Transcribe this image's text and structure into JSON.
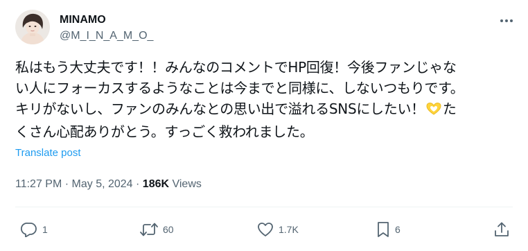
{
  "author": {
    "display_name": "MINAMO",
    "handle": "@M_I_N_A_M_O_",
    "avatar_icon": "profile-photo"
  },
  "post": {
    "lines": [
      "私はもう大丈夫です！！みんなのコメントでHP回復！今後ファンじゃな",
      "い人にフォーカスするようなことは今までと同様に、しないつもりです。",
      "キリがないし、ファンのみんなとの思い出で溢れるSNSにしたい！",
      "た",
      "くさん心配ありがとう。すっごく救われました。"
    ],
    "emoji": "heart-hands"
  },
  "translate_label": "Translate post",
  "meta": {
    "time": "11:27 PM",
    "separator1": " · ",
    "date": "May 5, 2024",
    "separator2": " · ",
    "views_count": "186K",
    "views_label": " Views"
  },
  "actions": {
    "replies": "1",
    "reposts": "60",
    "likes": "1.7K",
    "bookmarks": "6"
  },
  "colors": {
    "text": "#0f1419",
    "secondary": "#536471",
    "link": "#1d9bf0",
    "emoji_heart": "#ffd43b"
  }
}
